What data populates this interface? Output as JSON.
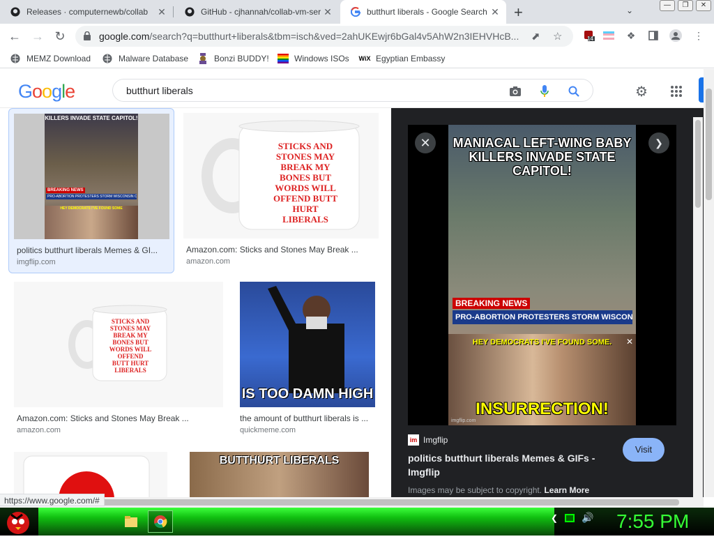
{
  "browser": {
    "tabs": [
      {
        "title": "Releases · computernewb/collab",
        "close": "✕"
      },
      {
        "title": "GitHub - cjhannah/collab-vm-ser",
        "close": "✕"
      },
      {
        "title": "butthurt liberals - Google Search",
        "close": "✕"
      }
    ],
    "new_tab": "+",
    "url_host": "google.com",
    "url_rest": "/search?q=butthurt+liberals&tbm=isch&ved=2ahUKEwjr6bGal4v5AhW2n3IEHVHcB...",
    "ext_badge": "14",
    "bookmarks": [
      {
        "label": "MEMZ Download"
      },
      {
        "label": "Malware Database"
      },
      {
        "label": "Bonzi BUDDY!"
      },
      {
        "label": "Windows ISOs"
      },
      {
        "label": "Egyptian Embassy"
      }
    ]
  },
  "google": {
    "logo": "Google",
    "query": "butthurt liberals"
  },
  "results": [
    {
      "caption": "politics butthurt liberals Memes & GI...",
      "source": "imgflip.com",
      "meme_top": "KILLERS INVADE STATE CAPITOL!",
      "meme_news": "BREAKING NEWS",
      "meme_sub": "PRO-ABORTION PROTESTERS STORM WISCONSIN CAPITOL",
      "meme_bottom": "HEY DEMOCRATS I'VE FOUND SOME"
    },
    {
      "caption": "Amazon.com: Sticks and Stones May Break ...",
      "source": "amazon.com",
      "mug_text": "STICKS AND STONES MAY BREAK MY BONES BUT WORDS WILL OFFEND BUTT HURT LIBERALS"
    },
    {
      "caption": "Amazon.com: Sticks and Stones May Break ...",
      "source": "amazon.com",
      "mug_text": "STICKS AND STONES MAY BREAK MY BONES BUT WORDS WILL OFFEND BUTT HURT LIBERALS"
    },
    {
      "caption": "the amount of butthurt liberals is ...",
      "source": "quickmeme.com",
      "meme_text": "IS TOO DAMN HIGH"
    },
    {
      "caption": "",
      "source": ""
    },
    {
      "caption": "",
      "source": "",
      "meme_text": "BUTTHURT LIBERALS"
    }
  ],
  "preview": {
    "meme_top": "MANIACAL LEFT-WING BABY KILLERS INVADE STATE CAPITOL!",
    "meme_news": "BREAKING NEWS",
    "meme_sub": "PRO-ABORTION PROTESTERS STORM WISCONSIN CAPITOL",
    "meme_mid": "HEY DEMOCRATS I'VE FOUND SOME.",
    "meme_bottom": "INSURRECTION!",
    "watermark": "imgflip.com",
    "source": "Imgflip",
    "title": "politics butthurt liberals Memes & GIFs - Imgflip",
    "visit": "Visit",
    "copyright": "Images may be subject to copyright.",
    "learn_more": "Learn More"
  },
  "status_url": "https://www.google.com/#",
  "taskbar": {
    "clock": "7:55 PM"
  },
  "colors": {
    "google_blue": "#4285f4",
    "google_red": "#ea4335",
    "google_yellow": "#fbbc05",
    "google_green": "#34a853",
    "clock_green": "#35ff35",
    "visit_button": "#8ab4f8"
  }
}
